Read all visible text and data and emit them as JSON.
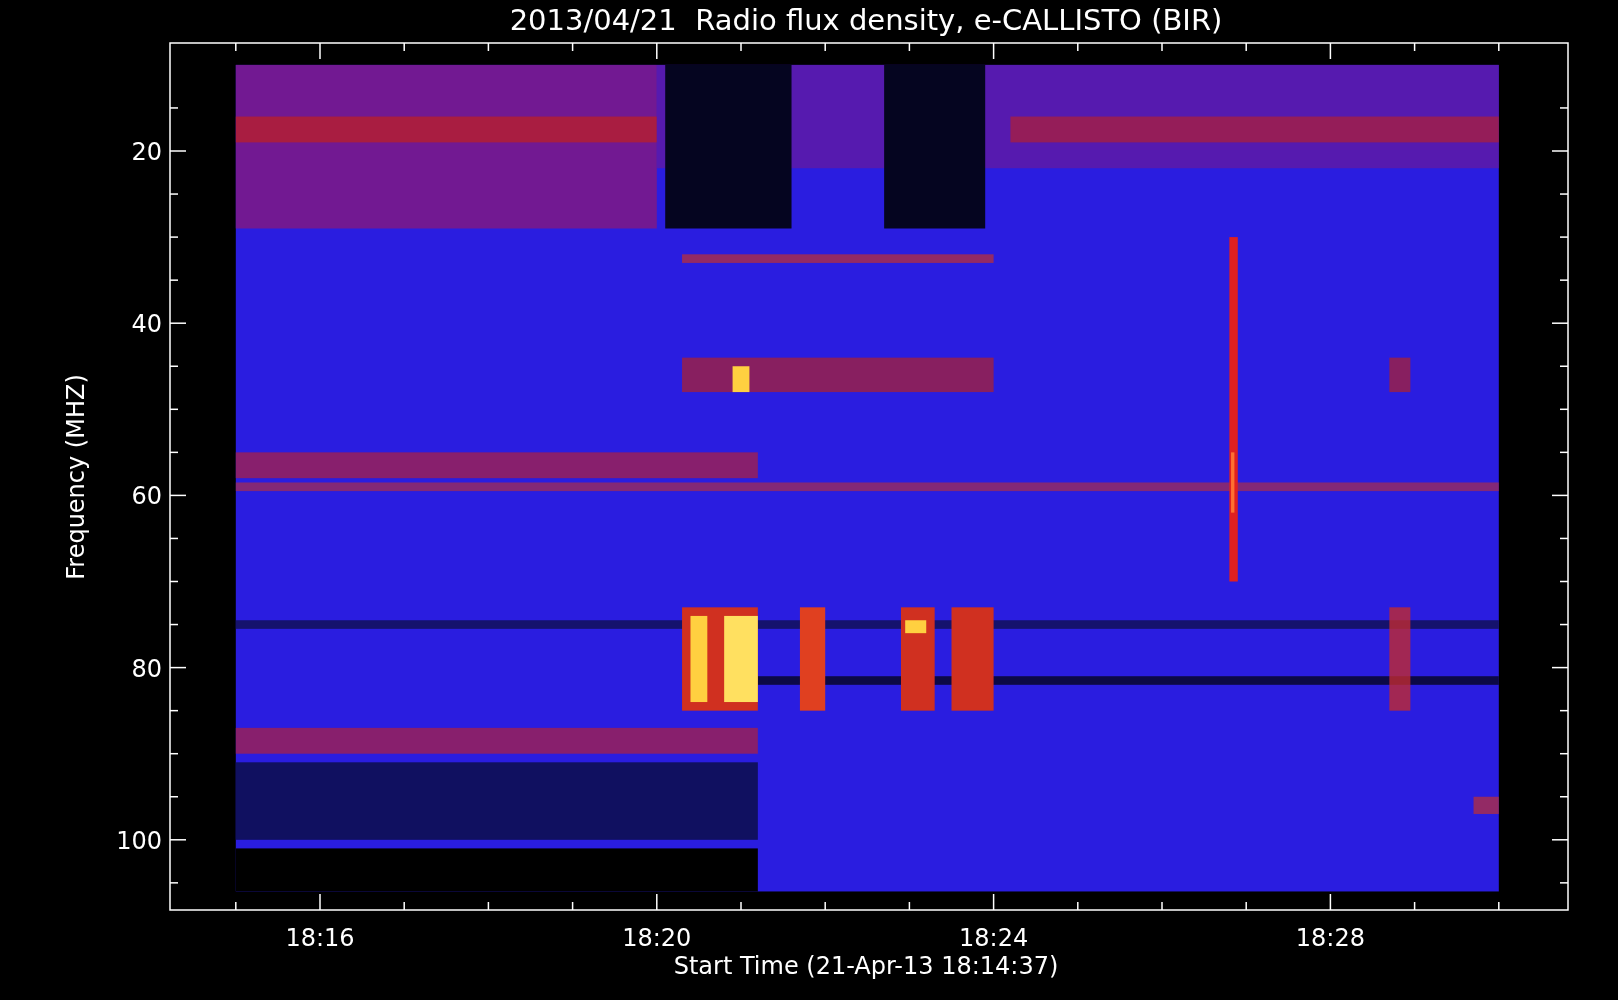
{
  "title": "2013/04/21  Radio flux density, e-CALLISTO (BIR)",
  "y_axis": {
    "label": "Frequency (MHZ)",
    "ticks": [
      "20",
      "40",
      "60",
      "80",
      "100"
    ]
  },
  "x_axis": {
    "label": "Start Time (21-Apr-13 18:14:37)",
    "ticks": [
      "18:16",
      "18:20",
      "18:24",
      "18:28"
    ]
  }
}
